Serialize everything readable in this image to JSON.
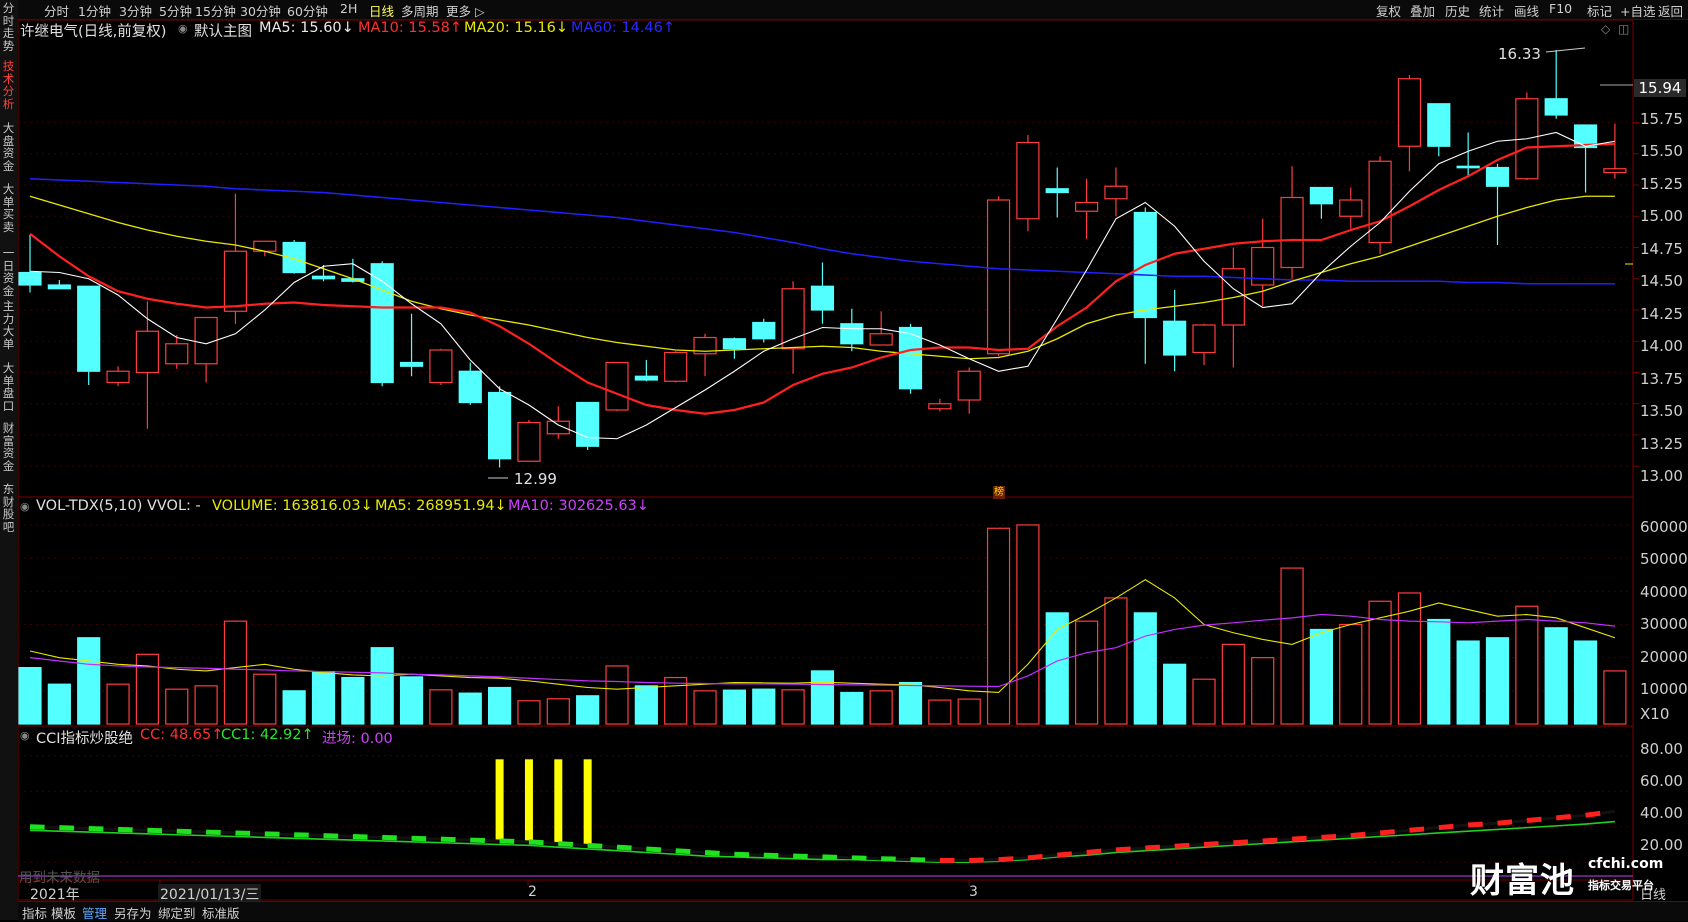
{
  "sidebar": {
    "items": [
      {
        "label": "分时走势",
        "active": false
      },
      {
        "label": "技术分析",
        "active": true
      },
      {
        "label": "大盘资金",
        "active": false
      },
      {
        "label": "大单买卖",
        "active": false
      },
      {
        "label": "一日资金",
        "active": false
      },
      {
        "label": "主力大单",
        "active": false
      },
      {
        "label": "大单盘口",
        "active": false
      },
      {
        "label": "财富资金",
        "active": false
      },
      {
        "label": "东财股吧",
        "active": false
      }
    ]
  },
  "toolbar": {
    "periods": [
      "分时",
      "1分钟",
      "3分钟",
      "5分钟",
      "15分钟",
      "30分钟",
      "60分钟",
      "2H",
      "日线",
      "多周期",
      "更多 ▷"
    ],
    "active_period": "日线",
    "right_tools": [
      "复权",
      "叠加",
      "历史",
      "统计",
      "画线",
      "F10",
      "标记",
      "+自选",
      "返回"
    ]
  },
  "main_chart": {
    "stock_title": "许继电气(日线,前复权)",
    "template": "默认主图",
    "ma5": "MA5: 15.60↓",
    "ma10": "MA10: 15.58↑",
    "ma20": "MA20: 15.16↓",
    "ma60": "MA60: 14.46↑",
    "max_label": "16.33",
    "min_label": "12.99",
    "current_price": "15.94",
    "y_ticks": [
      "15.75",
      "15.50",
      "15.25",
      "15.00",
      "14.75",
      "14.50",
      "14.25",
      "14.00",
      "13.75",
      "13.50",
      "13.25",
      "13.00"
    ],
    "badge": "榜"
  },
  "volume_panel": {
    "title": "VOL-TDX(5,10) VVOL: -",
    "volume": "VOLUME: 163816.03↓",
    "ma5": "MA5: 268951.94↓",
    "ma10": "MA10: 302625.63↓",
    "y_ticks": [
      "60000",
      "50000",
      "40000",
      "30000",
      "20000",
      "10000"
    ],
    "unit": "X10"
  },
  "cci_panel": {
    "title": "CCI指标炒股绝",
    "cc": "CC: 48.65↑",
    "cc1": "CC1: 42.92↑",
    "entry": "进场: 0.00",
    "y_ticks": [
      "80.00",
      "60.00",
      "40.00",
      "20.00"
    ],
    "note": "用到未来数据"
  },
  "date_axis": {
    "labels": [
      "2021年",
      "2021/01/13/三",
      "2",
      "3"
    ],
    "period_label": "日线"
  },
  "bottom_tabs": [
    "指标",
    "模板",
    "管理",
    "另存为",
    "绑定到",
    "标准版"
  ],
  "active_bottom_tab": "管理",
  "watermark": {
    "brand": "财富池",
    "url": "cfchi.com",
    "sub": "指标交易平台"
  },
  "colors": {
    "up": "#ff3c3c",
    "down": "#54ffff",
    "ma5": "#ffffff",
    "ma10": "#ff2020",
    "ma20": "#e8e800",
    "ma60": "#2020ff",
    "vol_ma10": "#c030ff"
  },
  "chart_data": {
    "type": "candlestick",
    "y_range": [
      12.9,
      16.45
    ],
    "candles": [
      {
        "o": 14.55,
        "h": 14.85,
        "l": 14.39,
        "c": 14.45
      },
      {
        "o": 14.45,
        "h": 14.49,
        "l": 14.42,
        "c": 14.42
      },
      {
        "o": 14.44,
        "h": 14.44,
        "l": 13.65,
        "c": 13.76
      },
      {
        "o": 13.67,
        "h": 13.8,
        "l": 13.64,
        "c": 13.76
      },
      {
        "o": 13.75,
        "h": 14.32,
        "l": 13.3,
        "c": 14.08
      },
      {
        "o": 13.82,
        "h": 14.05,
        "l": 13.78,
        "c": 13.98
      },
      {
        "o": 13.82,
        "h": 14.17,
        "l": 13.67,
        "c": 14.19
      },
      {
        "o": 14.24,
        "h": 15.18,
        "l": 14.14,
        "c": 14.72
      },
      {
        "o": 14.72,
        "h": 14.8,
        "l": 14.68,
        "c": 14.8
      },
      {
        "o": 14.79,
        "h": 14.81,
        "l": 14.54,
        "c": 14.55
      },
      {
        "o": 14.52,
        "h": 14.61,
        "l": 14.48,
        "c": 14.5
      },
      {
        "o": 14.5,
        "h": 14.66,
        "l": 14.47,
        "c": 14.48
      },
      {
        "o": 14.62,
        "h": 14.64,
        "l": 13.64,
        "c": 13.67
      },
      {
        "o": 13.83,
        "h": 14.22,
        "l": 13.72,
        "c": 13.8
      },
      {
        "o": 13.67,
        "h": 13.94,
        "l": 13.65,
        "c": 13.93
      },
      {
        "o": 13.76,
        "h": 13.83,
        "l": 13.49,
        "c": 13.51
      },
      {
        "o": 13.59,
        "h": 13.64,
        "l": 12.99,
        "c": 13.06
      },
      {
        "o": 13.04,
        "h": 13.37,
        "l": 13.04,
        "c": 13.35
      },
      {
        "o": 13.26,
        "h": 13.48,
        "l": 13.22,
        "c": 13.36
      },
      {
        "o": 13.51,
        "h": 13.51,
        "l": 13.13,
        "c": 13.16
      },
      {
        "o": 13.45,
        "h": 13.83,
        "l": 13.44,
        "c": 13.83
      },
      {
        "o": 13.72,
        "h": 13.85,
        "l": 13.68,
        "c": 13.69
      },
      {
        "o": 13.68,
        "h": 13.92,
        "l": 13.67,
        "c": 13.91
      },
      {
        "o": 13.9,
        "h": 14.06,
        "l": 13.72,
        "c": 14.03
      },
      {
        "o": 14.02,
        "h": 14.03,
        "l": 13.86,
        "c": 13.94
      },
      {
        "o": 14.15,
        "h": 14.18,
        "l": 13.99,
        "c": 14.02
      },
      {
        "o": 13.94,
        "h": 14.48,
        "l": 13.74,
        "c": 14.42
      },
      {
        "o": 14.44,
        "h": 14.63,
        "l": 14.14,
        "c": 14.25
      },
      {
        "o": 14.14,
        "h": 14.26,
        "l": 13.92,
        "c": 13.98
      },
      {
        "o": 13.97,
        "h": 14.24,
        "l": 13.97,
        "c": 14.06
      },
      {
        "o": 14.11,
        "h": 14.14,
        "l": 13.58,
        "c": 13.62
      },
      {
        "o": 13.46,
        "h": 13.54,
        "l": 13.44,
        "c": 13.5
      },
      {
        "o": 13.53,
        "h": 13.79,
        "l": 13.42,
        "c": 13.76
      },
      {
        "o": 13.9,
        "h": 15.16,
        "l": 13.88,
        "c": 15.13
      },
      {
        "o": 14.98,
        "h": 15.65,
        "l": 14.88,
        "c": 15.59
      },
      {
        "o": 15.22,
        "h": 15.39,
        "l": 14.99,
        "c": 15.19
      },
      {
        "o": 15.04,
        "h": 15.3,
        "l": 14.82,
        "c": 15.11
      },
      {
        "o": 15.14,
        "h": 15.39,
        "l": 15.0,
        "c": 15.24
      },
      {
        "o": 15.03,
        "h": 15.07,
        "l": 13.82,
        "c": 14.19
      },
      {
        "o": 14.16,
        "h": 14.41,
        "l": 13.76,
        "c": 13.89
      },
      {
        "o": 13.91,
        "h": 14.14,
        "l": 13.81,
        "c": 14.13
      },
      {
        "o": 14.13,
        "h": 14.75,
        "l": 13.79,
        "c": 14.58
      },
      {
        "o": 14.45,
        "h": 14.98,
        "l": 14.28,
        "c": 14.75
      },
      {
        "o": 14.59,
        "h": 15.4,
        "l": 14.5,
        "c": 15.15
      },
      {
        "o": 15.23,
        "h": 15.23,
        "l": 14.98,
        "c": 15.1
      },
      {
        "o": 15.0,
        "h": 15.23,
        "l": 14.9,
        "c": 15.13
      },
      {
        "o": 14.79,
        "h": 15.48,
        "l": 14.7,
        "c": 15.44
      },
      {
        "o": 15.56,
        "h": 16.13,
        "l": 15.36,
        "c": 16.1
      },
      {
        "o": 15.9,
        "h": 15.9,
        "l": 15.48,
        "c": 15.56
      },
      {
        "o": 15.4,
        "h": 15.67,
        "l": 15.31,
        "c": 15.39
      },
      {
        "o": 15.39,
        "h": 15.42,
        "l": 14.77,
        "c": 15.24
      },
      {
        "o": 15.3,
        "h": 15.99,
        "l": 15.29,
        "c": 15.94
      },
      {
        "o": 15.94,
        "h": 16.33,
        "l": 15.78,
        "c": 15.81
      },
      {
        "o": 15.73,
        "h": 15.73,
        "l": 15.19,
        "c": 15.55
      },
      {
        "o": 15.35,
        "h": 15.74,
        "l": 15.3,
        "c": 15.38
      }
    ],
    "ma5": [
      14.56,
      14.55,
      14.5,
      14.37,
      14.18,
      14.03,
      13.98,
      14.06,
      14.25,
      14.47,
      14.6,
      14.62,
      14.48,
      14.3,
      14.14,
      13.85,
      13.62,
      13.49,
      13.33,
      13.23,
      13.22,
      13.33,
      13.47,
      13.61,
      13.76,
      13.92,
      14.02,
      14.11,
      14.1,
      14.1,
      14.06,
      13.97,
      13.86,
      13.76,
      13.8,
      14.18,
      14.57,
      14.98,
      15.11,
      14.92,
      14.64,
      14.42,
      14.27,
      14.3,
      14.55,
      14.76,
      14.95,
      15.2,
      15.42,
      15.52,
      15.6,
      15.62,
      15.67,
      15.56,
      15.6
    ],
    "ma10": [
      14.86,
      14.68,
      14.52,
      14.4,
      14.34,
      14.3,
      14.27,
      14.28,
      14.3,
      14.31,
      14.29,
      14.28,
      14.27,
      14.27,
      14.27,
      14.23,
      14.12,
      13.98,
      13.82,
      13.67,
      13.58,
      13.49,
      13.45,
      13.42,
      13.45,
      13.51,
      13.65,
      13.74,
      13.79,
      13.87,
      13.93,
      13.95,
      13.95,
      13.93,
      13.94,
      14.12,
      14.27,
      14.48,
      14.61,
      14.7,
      14.74,
      14.78,
      14.8,
      14.81,
      14.81,
      14.89,
      14.96,
      15.08,
      15.21,
      15.32,
      15.45,
      15.55,
      15.56,
      15.57,
      15.58
    ],
    "ma20": [
      15.16,
      15.09,
      15.02,
      14.95,
      14.89,
      14.84,
      14.8,
      14.77,
      14.72,
      14.66,
      14.58,
      14.5,
      14.41,
      14.32,
      14.26,
      14.21,
      14.17,
      14.13,
      14.08,
      14.03,
      13.99,
      13.96,
      13.93,
      13.92,
      13.93,
      13.94,
      13.95,
      13.96,
      13.95,
      13.92,
      13.9,
      13.88,
      13.86,
      13.87,
      13.92,
      14.02,
      14.14,
      14.21,
      14.25,
      14.28,
      14.31,
      14.35,
      14.4,
      14.48,
      14.55,
      14.62,
      14.68,
      14.76,
      14.84,
      14.92,
      15.0,
      15.07,
      15.13,
      15.16,
      15.16
    ],
    "ma60": [
      15.3,
      15.29,
      15.28,
      15.27,
      15.26,
      15.25,
      15.24,
      15.22,
      15.21,
      15.2,
      15.19,
      15.17,
      15.15,
      15.13,
      15.11,
      15.09,
      15.07,
      15.05,
      15.03,
      15.01,
      14.99,
      14.96,
      14.93,
      14.9,
      14.87,
      14.83,
      14.79,
      14.74,
      14.7,
      14.67,
      14.64,
      14.62,
      14.6,
      14.58,
      14.57,
      14.56,
      14.55,
      14.54,
      14.53,
      14.52,
      14.52,
      14.51,
      14.5,
      14.49,
      14.49,
      14.48,
      14.48,
      14.48,
      14.48,
      14.47,
      14.47,
      14.46,
      14.46,
      14.46,
      14.46
    ],
    "volume": [
      17000,
      12000,
      26000,
      12000,
      21000,
      10500,
      11500,
      31000,
      15000,
      10000,
      15800,
      14000,
      23000,
      14200,
      10300,
      9300,
      11000,
      7000,
      7600,
      8500,
      17500,
      11500,
      14000,
      10000,
      10200,
      10500,
      10300,
      16000,
      9500,
      10000,
      12500,
      7200,
      7500,
      59000,
      60000,
      33500,
      31000,
      38000,
      33500,
      18000,
      13500,
      24000,
      20000,
      47000,
      28500,
      30000,
      37000,
      39500,
      31500,
      25000,
      26000,
      35500,
      29000,
      25000,
      16000
    ],
    "vol_ma5": [
      22000,
      20000,
      19000,
      18000,
      17500,
      16500,
      16000,
      17000,
      18000,
      16500,
      15500,
      14800,
      14500,
      15000,
      14500,
      14000,
      13800,
      13000,
      12000,
      11000,
      10500,
      11000,
      11500,
      12000,
      12500,
      12400,
      12300,
      12600,
      12300,
      12000,
      11800,
      11000,
      10000,
      9500,
      18000,
      28500,
      33000,
      38000,
      43500,
      38000,
      30000,
      27500,
      25500,
      24000,
      27500,
      30000,
      32000,
      34000,
      36500,
      34500,
      32500,
      33000,
      32000,
      29000,
      26000
    ],
    "vol_ma10": [
      20000,
      19000,
      18000,
      17500,
      17200,
      17000,
      16800,
      16500,
      16300,
      16000,
      15800,
      15600,
      15400,
      15000,
      14800,
      14500,
      14200,
      13800,
      13400,
      13000,
      12800,
      12500,
      12300,
      12200,
      12100,
      12100,
      12000,
      11900,
      11800,
      11700,
      11600,
      11500,
      11400,
      11300,
      14500,
      19000,
      21500,
      23000,
      26500,
      28500,
      29800,
      30500,
      31300,
      32000,
      33000,
      32500,
      31500,
      31000,
      30800,
      30500,
      31000,
      31500,
      31000,
      30500,
      29500
    ],
    "cci": [
      40,
      39.5,
      39,
      38.5,
      38,
      37.5,
      37,
      36.5,
      36,
      35.5,
      35,
      34.5,
      34,
      33.5,
      33,
      32.5,
      32,
      31.5,
      30.5,
      29.5,
      28.5,
      27.5,
      26.5,
      25.5,
      24.5,
      24,
      23.5,
      23,
      22.5,
      22,
      21.5,
      21,
      21,
      21.5,
      22.5,
      24,
      25.5,
      27,
      28,
      29,
      30,
      31,
      32,
      33,
      34,
      35,
      36.5,
      38,
      39.5,
      41,
      42,
      43.5,
      45,
      46.5,
      48.65
    ],
    "cci1": [
      38,
      37.5,
      37,
      36.5,
      36,
      35.5,
      35,
      34.5,
      34,
      33.5,
      33,
      32.5,
      32,
      31.5,
      31,
      30.5,
      30,
      29.5,
      28.5,
      27.5,
      26.5,
      25.5,
      24.5,
      23.5,
      23,
      22.5,
      22,
      21.5,
      21.5,
      21,
      20.5,
      20,
      20,
      20.5,
      21.5,
      23,
      24,
      25.5,
      26.5,
      27.5,
      28.5,
      29.5,
      30.5,
      31.5,
      32.5,
      33.5,
      34.5,
      35.5,
      36.5,
      37.5,
      38.5,
      39.5,
      40.5,
      41.5,
      42.92
    ],
    "entry_signals": [
      16,
      17,
      18,
      19
    ]
  }
}
